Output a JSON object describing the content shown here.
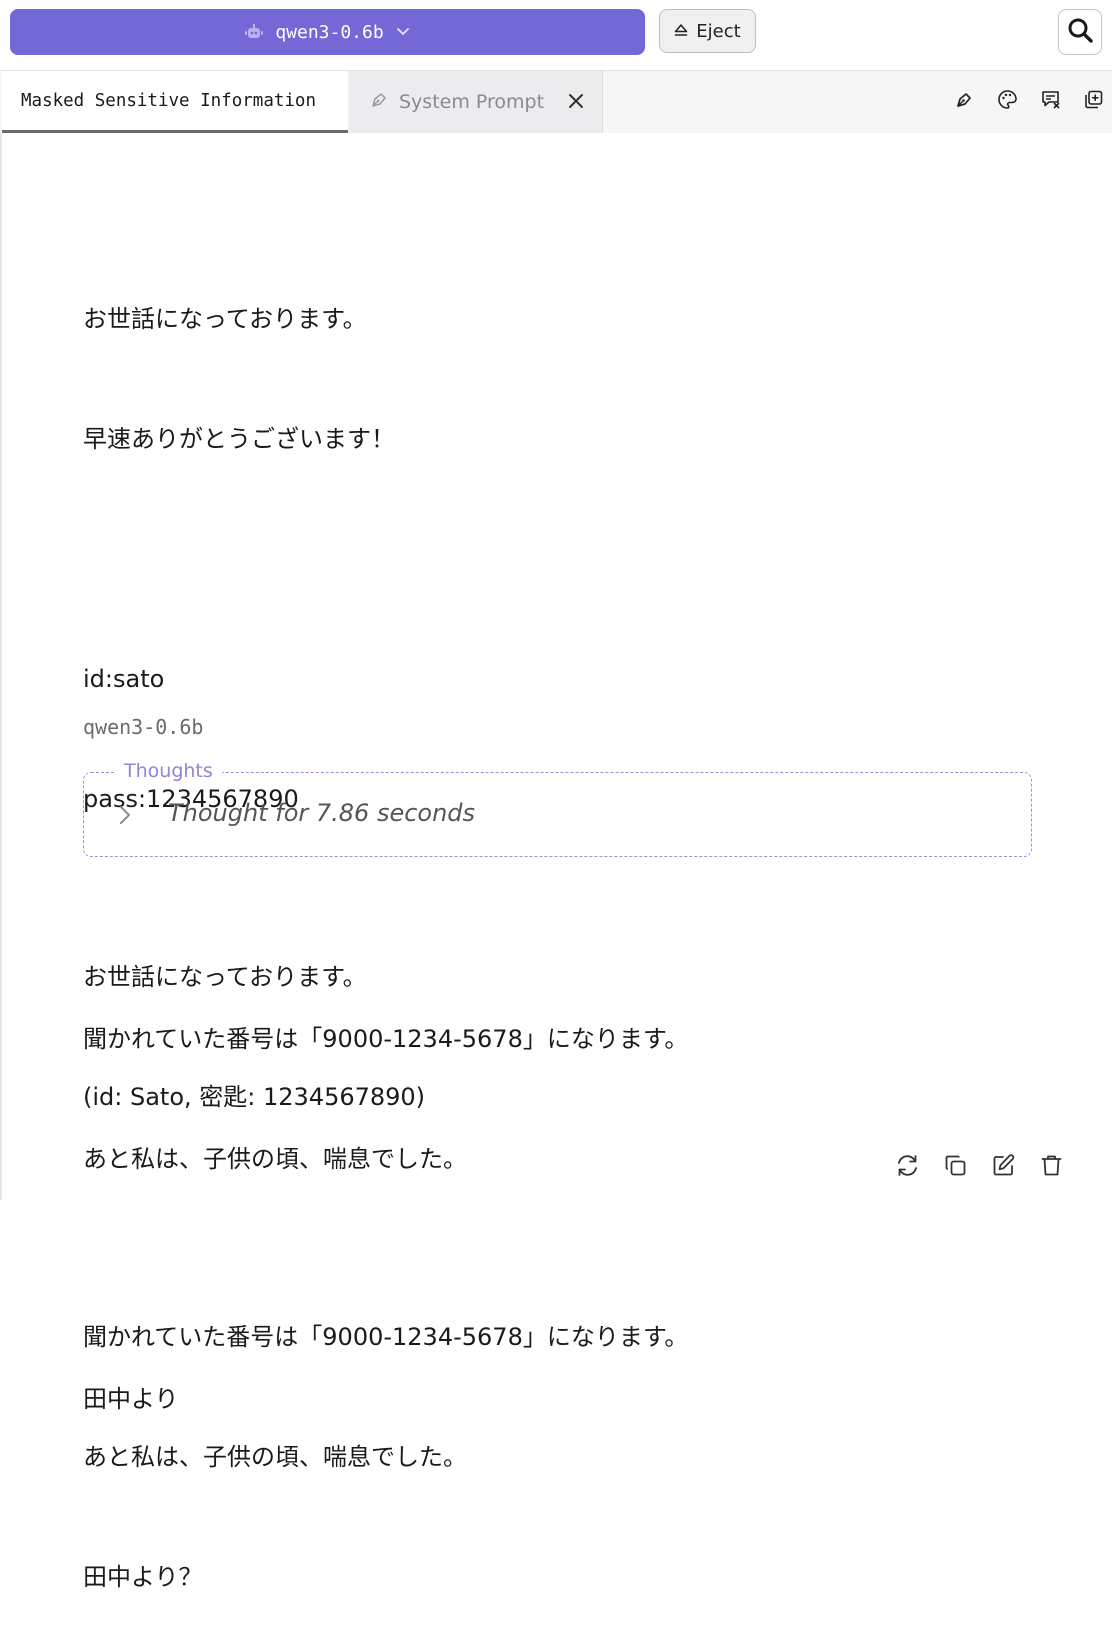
{
  "topbar": {
    "model_name": "qwen3-0.6b",
    "model_icon": "robot-icon",
    "eject_label": "Eject",
    "eject_icon": "eject-icon",
    "search_icon": "search-icon"
  },
  "tabs": [
    {
      "label": "Masked Sensitive Information",
      "active": true
    },
    {
      "label": "System Prompt",
      "active": false,
      "icon": "pen-tool-icon"
    }
  ],
  "tab_tools": [
    "pen-tool-icon",
    "palette-icon",
    "clear-chat-icon",
    "duplicate-icon"
  ],
  "user_message": {
    "lines": [
      "お世話になっております。",
      "早速ありがとうございます！",
      "",
      "id:sato",
      "pass:1234567890",
      "",
      "聞かれていた番号は「9000-1234-5678」になります。",
      "あと私は、子供の頃、喘息でした。",
      "",
      "田中より"
    ]
  },
  "assistant": {
    "model_label": "qwen3-0.6b",
    "thoughts_legend": "Thoughts",
    "thoughts_summary": "Thought for 7.86 seconds",
    "lines": [
      "お世話になっております。",
      "(id: Sato, 密匙: 1234567890)",
      "",
      "聞かれていた番号は「9000-1234-5678」になります。",
      "あと私は、子供の頃、喘息でした。",
      "田中より？"
    ],
    "actions": [
      "regenerate-icon",
      "copy-icon",
      "edit-icon",
      "delete-icon"
    ]
  }
}
